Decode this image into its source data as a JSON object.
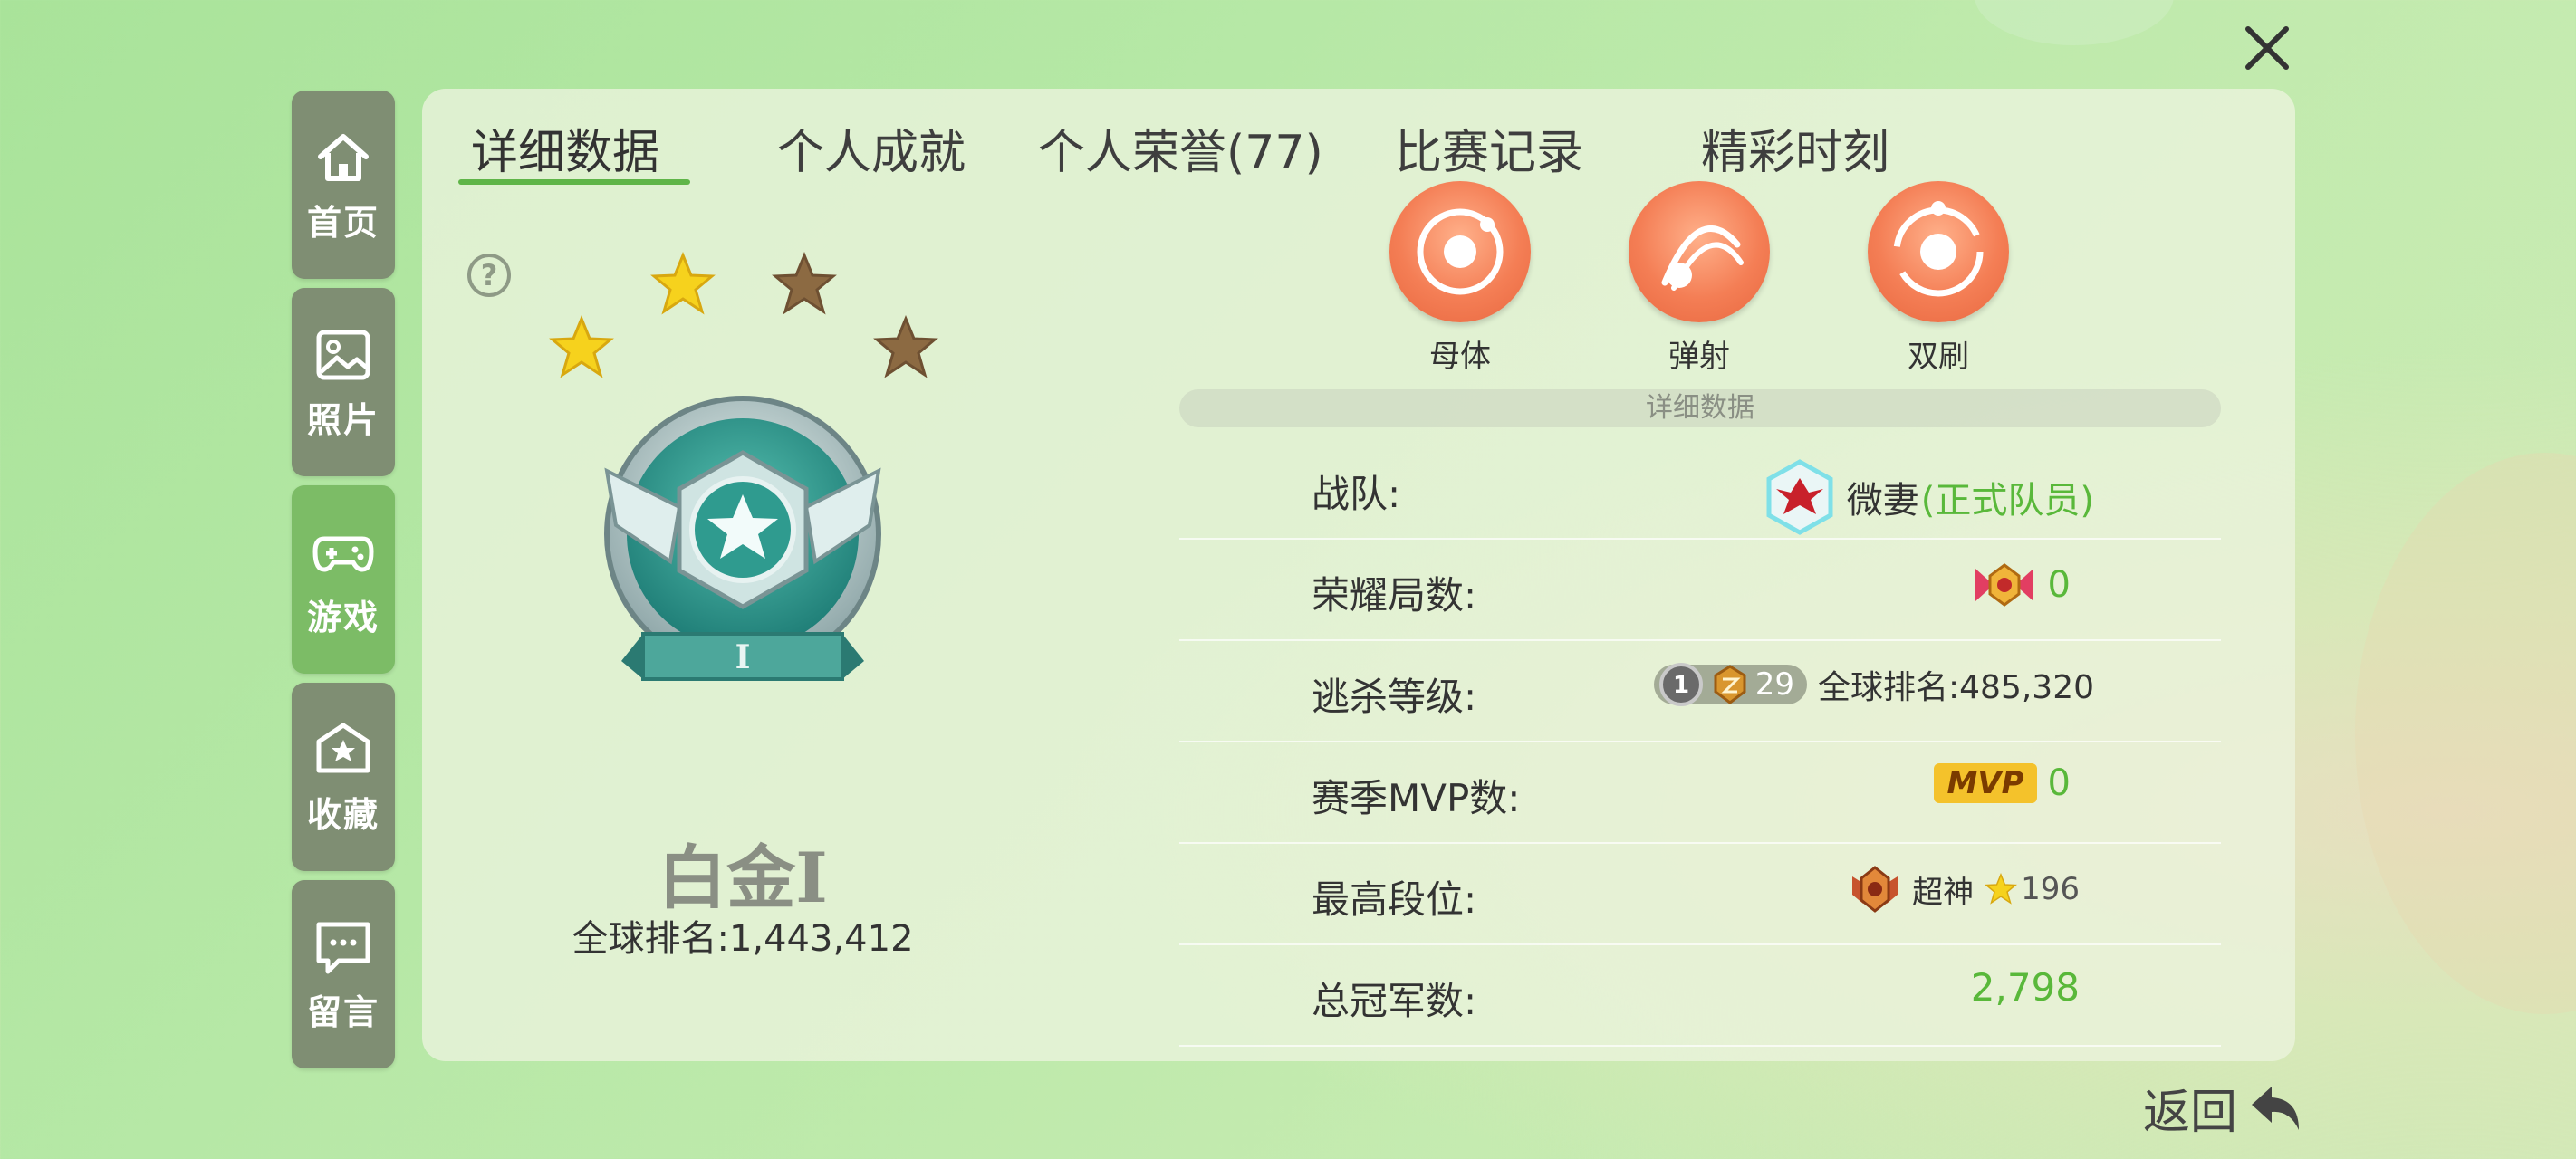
{
  "tabs": [
    "详细数据",
    "个人成就",
    "个人荣誉(77)",
    "比赛记录",
    "精彩时刻"
  ],
  "sidebar": {
    "items": [
      {
        "label": "首页",
        "icon": "home-icon"
      },
      {
        "label": "照片",
        "icon": "photo-icon"
      },
      {
        "label": "游戏",
        "icon": "gamepad-icon",
        "active": true
      },
      {
        "label": "收藏",
        "icon": "favorite-icon"
      },
      {
        "label": "留言",
        "icon": "message-icon"
      }
    ]
  },
  "help_symbol": "?",
  "rank": {
    "name": "白金Ⅰ",
    "global_rank": "全球排名:1,443,412",
    "stars_filled": 2,
    "stars_total": 4
  },
  "modes": [
    {
      "label": "母体",
      "icon": "mode-matrix-icon"
    },
    {
      "label": "弹射",
      "icon": "mode-bounce-icon"
    },
    {
      "label": "双刷",
      "icon": "mode-double-icon"
    }
  ],
  "details": {
    "header": "详细数据",
    "team": {
      "key": "战队:",
      "name": "微妻",
      "role": "(正式队员)"
    },
    "glory": {
      "key": "荣耀局数:",
      "value": "0"
    },
    "escape": {
      "key": "逃杀等级:",
      "level_prefix": "1",
      "level": "29",
      "rank": "全球排名:485,320"
    },
    "mvp": {
      "key": "赛季MVP数:",
      "badge": "MVP",
      "value": "0"
    },
    "highest": {
      "key": "最高段位:",
      "tier": "超神",
      "stars": "196"
    },
    "champions": {
      "key": "总冠军数:",
      "value": "2,798"
    }
  },
  "back_label": "返回",
  "colors": {
    "accent_green": "#5fb548",
    "sidebar_active": "#7cbc66",
    "sidebar_inactive": "#7f8e73",
    "mode_orange": "#f47e55"
  }
}
